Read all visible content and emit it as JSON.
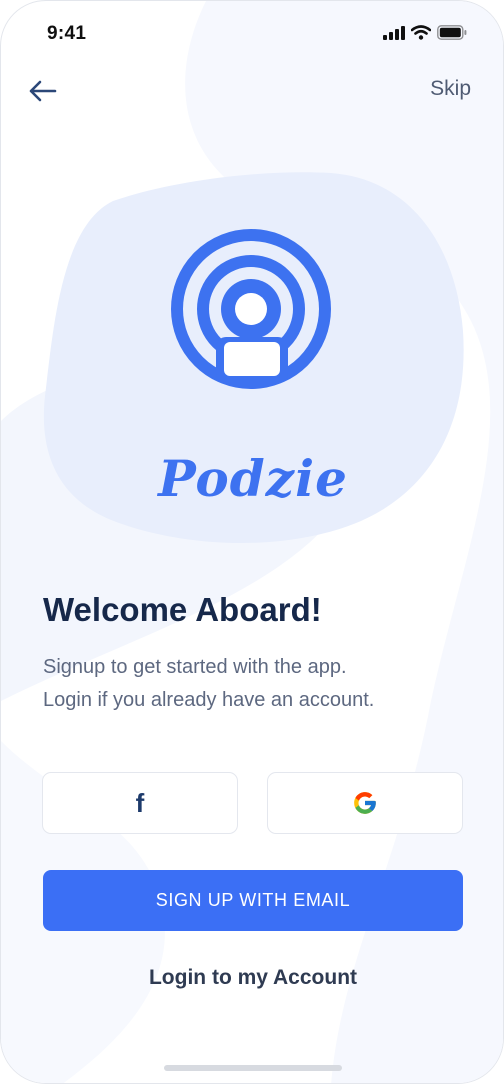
{
  "status_bar": {
    "time": "9:41",
    "icons": [
      "signal-icon",
      "wifi-icon",
      "battery-icon"
    ]
  },
  "header": {
    "back_icon": "arrow-left-icon",
    "skip_label": "Skip"
  },
  "brand": {
    "logo_icon": "podcast-icon",
    "name": "Podzie"
  },
  "welcome": {
    "title": "Welcome Aboard!",
    "subtitle_line1": "Signup to get started with the app.",
    "subtitle_line2": "Login if you already have an account."
  },
  "social": {
    "facebook_glyph": "f",
    "facebook_icon": "facebook-icon",
    "google_icon": "google-icon"
  },
  "actions": {
    "signup_label": "SIGN UP WITH EMAIL",
    "login_label": "Login to my Account"
  },
  "colors": {
    "accent": "#3b6ff5",
    "title": "#16284a",
    "body_text": "#5d6880",
    "blob": "#e8eefc"
  }
}
